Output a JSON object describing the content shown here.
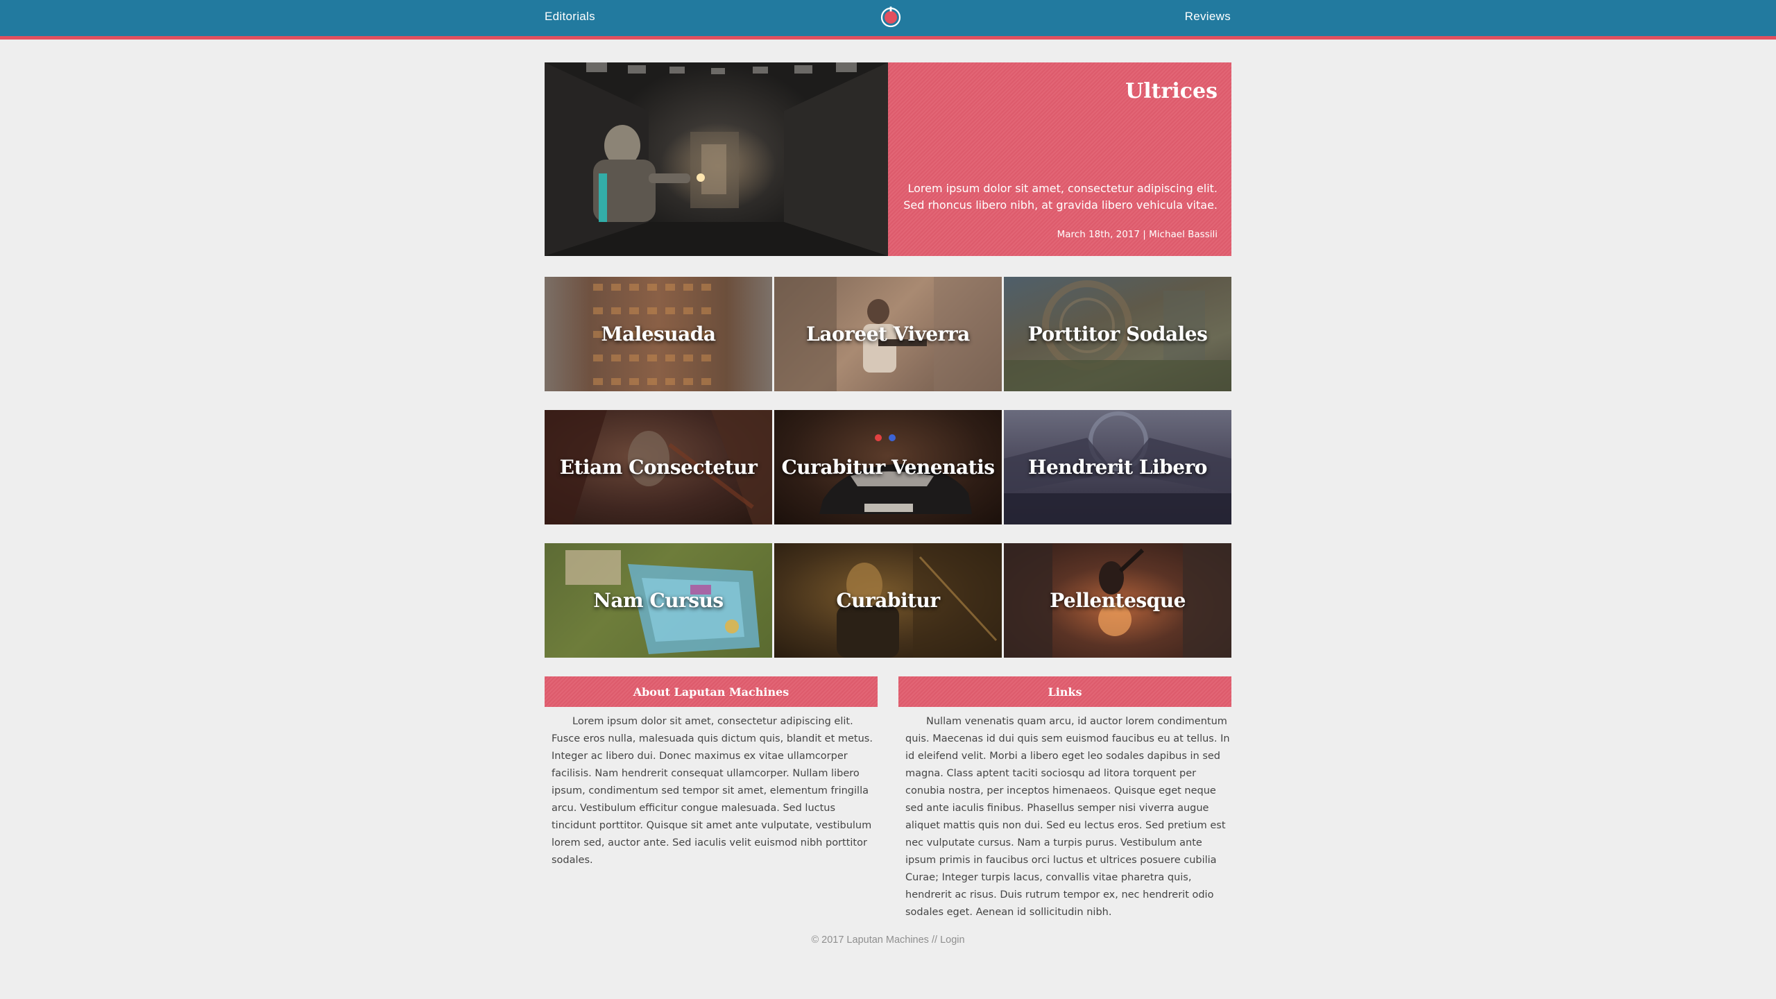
{
  "header": {
    "left_link": "Editorials",
    "right_link": "Reviews",
    "logo_icon": "circle-logo-icon",
    "bar_color": "#227a9f",
    "accent_color": "#e2505f"
  },
  "hero": {
    "title": "Ultrices",
    "excerpt": "Lorem ipsum dolor sit amet, consectetur adipiscing elit. Sed rhoncus libero nibh, at gravida libero vehicula vitae.",
    "meta": "March 18th, 2017 | Michael Bassili",
    "panel_color": "#e15d6e"
  },
  "tiles": [
    {
      "title": "Malesuada"
    },
    {
      "title": "Laoreet Viverra"
    },
    {
      "title": "Porttitor Sodales"
    },
    {
      "title": "Etiam Consectetur"
    },
    {
      "title": "Curabitur Venenatis"
    },
    {
      "title": "Hendrerit Libero"
    },
    {
      "title": "Nam Cursus"
    },
    {
      "title": "Curabitur"
    },
    {
      "title": "Pellentesque"
    }
  ],
  "about": {
    "heading": "About Laputan Machines",
    "body": "Lorem ipsum dolor sit amet, consectetur adipiscing elit. Fusce eros nulla, malesuada quis dictum quis, blandit et metus. Integer ac libero dui. Donec maximus ex vitae ullamcorper facilisis. Nam hendrerit consequat ullamcorper. Nullam libero ipsum, condimentum sed tempor sit amet, elementum fringilla arcu. Vestibulum efficitur congue malesuada. Sed luctus tincidunt porttitor. Quisque sit amet ante vulputate, vestibulum lorem sed, auctor ante. Sed iaculis velit euismod nibh porttitor sodales."
  },
  "links": {
    "heading": "Links",
    "body": "Nullam venenatis quam arcu, id auctor lorem condimentum quis. Maecenas id dui quis sem euismod faucibus eu at tellus. In id eleifend velit. Morbi a libero eget leo sodales dapibus in sed magna. Class aptent taciti sociosqu ad litora torquent per conubia nostra, per inceptos himenaeos. Quisque eget neque sed ante iaculis finibus. Phasellus semper nisi viverra augue aliquet mattis quis non dui. Sed eu lectus eros. Sed pretium est nec vulputate cursus. Nam a turpis purus. Vestibulum ante ipsum primis in faucibus orci luctus et ultrices posuere cubilia Curae; Integer turpis lacus, convallis vitae pharetra quis, hendrerit ac risus. Duis rutrum tempor ex, nec hendrerit odio sodales eget. Aenean id sollicitudin nibh."
  },
  "footer": {
    "copyright": "© 2017 Laputan Machines //",
    "login": "Login"
  }
}
